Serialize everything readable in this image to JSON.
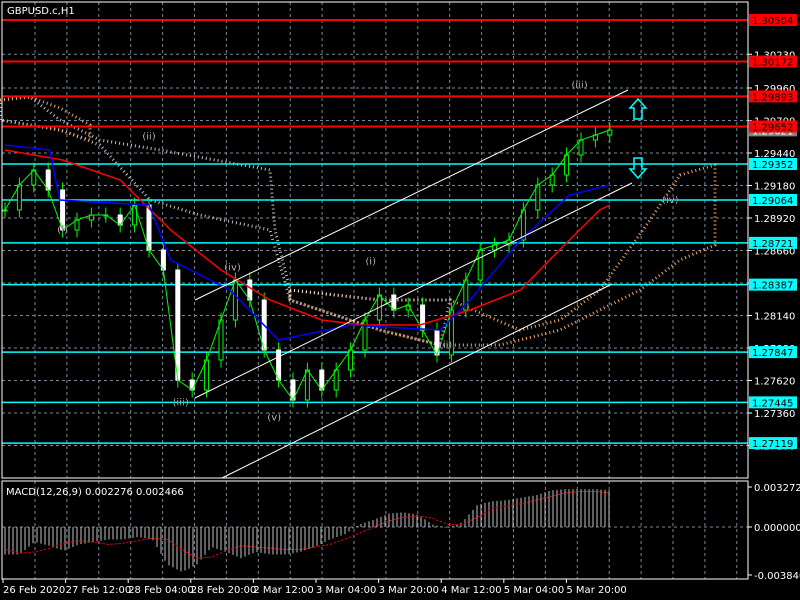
{
  "window": {
    "title": "GBPUSD.c,H1"
  },
  "chart_data": {
    "type": "line",
    "symbol": "GBPUSD.c,H1",
    "y_ticks": [
      1.3023,
      1.2996,
      1.297,
      1.2944,
      1.2918,
      1.2892,
      1.2866,
      1.284,
      1.2814,
      1.2788,
      1.2762,
      1.2736,
      1.271
    ],
    "y_tick_labels": [
      "1.30230",
      "1.29960",
      "1.29700",
      "1.29440",
      "1.29180",
      "1.28920",
      "1.28660",
      "1.28400",
      "1.28140",
      "1.27880",
      "1.27620",
      "1.27360",
      "1.27100"
    ],
    "x_labels": [
      "26 Feb 2020",
      "27 Feb 12:00",
      "28 Feb 04:00",
      "28 Feb 20:00",
      "2 Mar 12:00",
      "3 Mar 04:00",
      "3 Mar 20:00",
      "4 Mar 12:00",
      "5 Mar 04:00",
      "5 Mar 20:00"
    ],
    "red_levels": [
      {
        "value": 1.30504,
        "label": "1.30504"
      },
      {
        "value": 1.30172,
        "label": "1.30172"
      },
      {
        "value": 1.29893,
        "label": "1.29893"
      },
      {
        "value": 1.29652,
        "label": "1.29652"
      }
    ],
    "cyan_levels": [
      {
        "value": 1.29352,
        "label": "1.29352"
      },
      {
        "value": 1.29064,
        "label": "1.29064"
      },
      {
        "value": 1.28721,
        "label": "1.28721"
      },
      {
        "value": 1.28387,
        "label": "1.28387"
      },
      {
        "value": 1.27847,
        "label": "1.27847"
      },
      {
        "value": 1.27445,
        "label": "1.27445"
      },
      {
        "value": 1.27119,
        "label": "1.27119"
      }
    ],
    "bid": {
      "value": 1.29621,
      "label": "1.29621"
    },
    "close": [
      1.28984,
      1.29184,
      1.29304,
      1.29144,
      1.28824,
      1.28904,
      1.28944,
      1.28944,
      1.28864,
      1.29024,
      1.28664,
      1.28504,
      1.27624,
      1.27544,
      1.27784,
      1.28104,
      1.28424,
      1.28264,
      1.27864,
      1.27624,
      1.27464,
      1.27704,
      1.27544,
      1.27704,
      1.27864,
      1.28104,
      1.28304,
      1.28184,
      1.28224,
      1.28024,
      1.27824,
      1.28184,
      1.28424,
      1.28664,
      1.28704,
      1.28744,
      1.28984,
      1.29184,
      1.29264,
      1.29424,
      1.29544,
      1.29584,
      1.29624
    ],
    "ma_red": [
      [
        0,
        1.29464
      ],
      [
        4,
        1.29384
      ],
      [
        8,
        1.29224
      ],
      [
        11.5,
        1.28824
      ],
      [
        15,
        1.28504
      ],
      [
        18.4,
        1.28264
      ],
      [
        22,
        1.28104
      ],
      [
        24.7,
        1.28064
      ],
      [
        28.8,
        1.28064
      ],
      [
        32.3,
        1.28184
      ],
      [
        35.8,
        1.28344
      ],
      [
        38.5,
        1.28664
      ],
      [
        41.3,
        1.28984
      ],
      [
        42,
        1.29024
      ]
    ],
    "ma_blue": [
      [
        0,
        1.29504
      ],
      [
        3.1,
        1.29464
      ],
      [
        3.8,
        1.29064
      ],
      [
        10,
        1.29024
      ],
      [
        11.5,
        1.28584
      ],
      [
        15.6,
        1.28344
      ],
      [
        19,
        1.27944
      ],
      [
        24,
        1.28064
      ],
      [
        30.2,
        1.28024
      ],
      [
        32.3,
        1.28264
      ],
      [
        35.8,
        1.28744
      ],
      [
        39.2,
        1.29104
      ],
      [
        42,
        1.29184
      ]
    ],
    "wave_labels": [
      {
        "text": "(i)",
        "bar": 4,
        "price": 1.288
      },
      {
        "text": "(ii)",
        "bar": 10,
        "price": 1.2955
      },
      {
        "text": "(iii)",
        "bar": 12.2,
        "price": 1.2742
      },
      {
        "text": "(iv)",
        "bar": 15.8,
        "price": 1.285
      },
      {
        "text": "(v)",
        "bar": 18.7,
        "price": 1.273
      },
      {
        "text": "(i)",
        "bar": 25.4,
        "price": 1.2855
      },
      {
        "text": "(ii)",
        "bar": 30.6,
        "price": 1.2788
      },
      {
        "text": "(iii)",
        "bar": 39.9,
        "price": 1.2996
      },
      {
        "text": "(iv)",
        "bar": 46.2,
        "price": 1.2904
      }
    ],
    "macd": {
      "label": "MACD(12,26,9) 0.002276 0.002466",
      "ylim": [
        -0.00384,
        0.003272
      ],
      "tick_labels": [
        "0.003272",
        "0.000000",
        "-0.003840"
      ],
      "histogram": [
        -0.0022,
        -0.0022,
        -0.0012,
        -0.0015,
        -0.0019,
        -0.0014,
        -0.0012,
        -0.001,
        -0.001,
        -0.0008,
        -0.001,
        -0.003,
        -0.0036,
        -0.003,
        -0.0016,
        -0.002,
        -0.0025,
        -0.002,
        -0.0022,
        -0.0022,
        -0.002,
        -0.0016,
        -0.001,
        -0.0006,
        0.0002,
        0.0006,
        0.0011,
        0.0012,
        0.001,
        0.0002,
        -0.0001,
        0.0004,
        0.0018,
        0.0021,
        0.0022,
        0.0024,
        0.0026,
        0.003,
        0.0031,
        0.0031,
        0.0031,
        0.003
      ],
      "signal": [
        -0.0018,
        -0.0021,
        -0.002,
        -0.0017,
        -0.0013,
        -0.0011,
        -0.0012,
        -0.0014,
        -0.0013,
        -0.0011,
        -0.0009,
        -0.001,
        -0.0018,
        -0.0025,
        -0.0024,
        -0.0019,
        -0.0015,
        -0.0016,
        -0.0017,
        -0.0018,
        -0.0018,
        -0.0016,
        -0.0014,
        -0.001,
        -0.0005,
        0.0,
        0.0005,
        0.0008,
        0.0009,
        0.0007,
        0.0002,
        0.0002,
        0.0008,
        0.0015,
        0.0017,
        0.0019,
        0.0022,
        0.0025,
        0.0028,
        0.0029,
        0.0029,
        0.0028
      ]
    },
    "colors": {
      "bull": "#00ff00",
      "red_line": "#ff0000",
      "cyan_line": "#00ffff",
      "ma_red": "#ff0000",
      "ma_blue": "#0000ff",
      "grid": "#778899",
      "cloud_a": "#ffffff",
      "cloud_b": "#f4a460"
    }
  }
}
